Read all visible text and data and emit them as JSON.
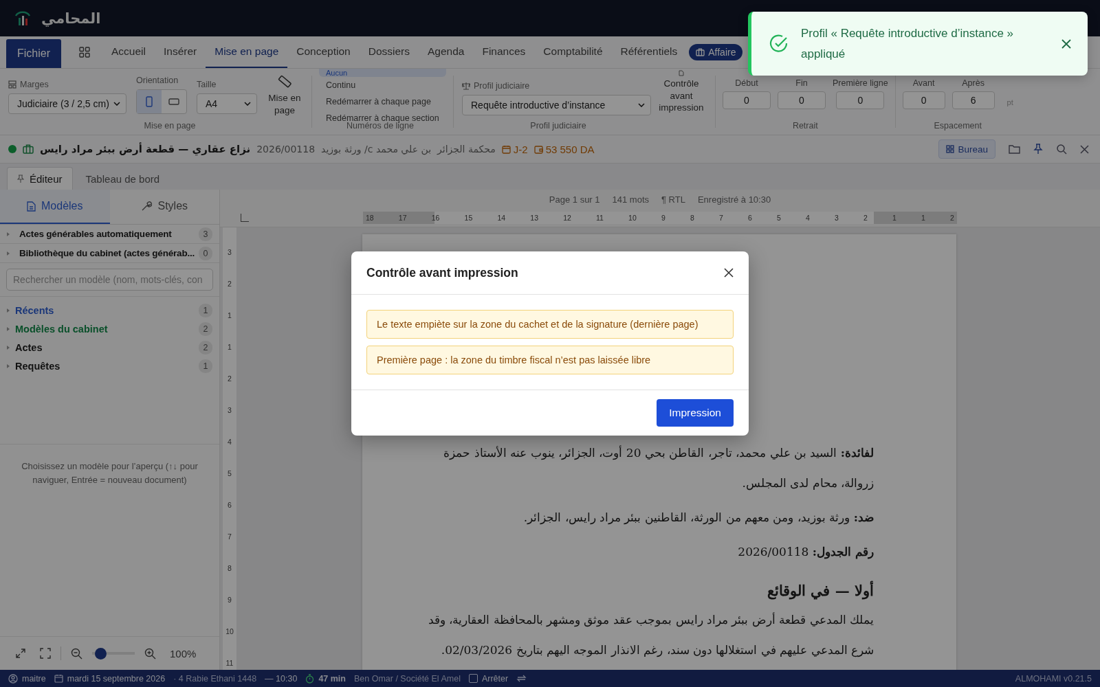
{
  "app": {
    "logo_text": "المحامي"
  },
  "menu": {
    "file_button": "Fichier",
    "tabs": [
      {
        "label": "Accueil",
        "selected": false
      },
      {
        "label": "Insérer",
        "selected": false
      },
      {
        "label": "Mise en page",
        "selected": true
      },
      {
        "label": "Conception",
        "selected": false
      },
      {
        "label": "Dossiers",
        "selected": false
      },
      {
        "label": "Agenda",
        "selected": false
      },
      {
        "label": "Finances",
        "selected": false
      },
      {
        "label": "Comptabilité",
        "selected": false
      },
      {
        "label": "Référentiels",
        "selected": false
      }
    ],
    "affaire_button": "Affaire"
  },
  "ribbon": {
    "margins": {
      "label": "Marges",
      "value": "Judiciaire (3 / 2,5 cm)"
    },
    "orientation": {
      "label": "Orientation",
      "options": [
        {
          "kind": "portrait",
          "selected": true
        },
        {
          "kind": "landscape",
          "selected": false
        }
      ]
    },
    "size": {
      "label": "Taille",
      "value": "A4"
    },
    "page_group_label": "Mise en page",
    "layout_button": "Mise en page",
    "line_numbers": {
      "options": [
        {
          "label": "Aucun",
          "selected": true
        },
        {
          "label": "Continu",
          "selected": false
        },
        {
          "label": "Redémarrer à chaque page",
          "selected": false
        },
        {
          "label": "Redémarrer à chaque section",
          "selected": false
        }
      ],
      "group_label": "Numéros de ligne"
    },
    "profile": {
      "label": "Profil judiciaire",
      "value": "Requête introductive d’instance",
      "group_label": "Profil judiciaire"
    },
    "print_check_button": "Contrôle avant impression",
    "indent": {
      "fields": [
        {
          "label": "Début",
          "value": "0"
        },
        {
          "label": "Fin",
          "value": "0"
        },
        {
          "label": "Première ligne",
          "value": "0"
        }
      ],
      "group_label": "Retrait"
    },
    "spacing": {
      "fields": [
        {
          "label": "Avant",
          "value": "0"
        },
        {
          "label": "Après",
          "value": "6"
        }
      ],
      "unit": "pt",
      "group_label": "Espacement"
    }
  },
  "case_bar": {
    "title": "نزاع عقاري — قطعة أرض ببئر مراد رايس",
    "number": "2026/00118",
    "parties": "بن علي محمد c/ ورثة بوزيد",
    "court": "محكمة الجزائر",
    "deadline": "J-2",
    "amount": "53 550 DA",
    "bureau_button": "Bureau"
  },
  "editor_tabs": [
    {
      "label": "Éditeur",
      "selected": true
    },
    {
      "label": "Tableau de bord",
      "selected": false
    }
  ],
  "sidebar": {
    "tabs": [
      {
        "label": "Modèles",
        "selected": true
      },
      {
        "label": "Styles",
        "selected": false
      }
    ],
    "sections": [
      {
        "label": "Actes générables automatiquement",
        "count": "3",
        "expanded": false
      },
      {
        "label": "Bibliothèque du cabinet (actes générab...",
        "count": "0",
        "expanded": false
      }
    ],
    "search": {
      "placeholder": "Rechercher un modèle (nom, mots-clés, con"
    },
    "categories": [
      {
        "label": "Récents",
        "count": "1",
        "kind": "recent",
        "expanded": false
      },
      {
        "label": "Modèles du cabinet",
        "count": "2",
        "kind": "firm",
        "expanded": false
      },
      {
        "label": "Actes",
        "count": "2",
        "kind": "folder",
        "expanded": false
      },
      {
        "label": "Requêtes",
        "count": "1",
        "kind": "folder",
        "expanded": false
      }
    ],
    "hint": "Choisissez un modèle pour l’aperçu (↑↓ pour naviguer, Entrée = nouveau document)",
    "zoom": {
      "level": 0.08,
      "reading": "100%"
    }
  },
  "document": {
    "status": [
      "Page 1 sur 1",
      "141 mots",
      "¶ RTL",
      "Enregistré à 10:30"
    ],
    "ruler": [
      "18",
      "17",
      "16",
      "15",
      "14",
      "13",
      "12",
      "11",
      "10",
      "9",
      "8",
      "7",
      "6",
      "5",
      "4",
      "3",
      "2",
      "1",
      "1",
      "2"
    ],
    "vertical_ruler": [
      "3",
      "2",
      "1",
      "1",
      "2",
      "3",
      "4",
      "5",
      "6",
      "7",
      "8",
      "9",
      "10",
      "11"
    ],
    "paragraphs": [
      {
        "kind": "text",
        "text": "**لفائدة:** السيد بن علي محمد، تاجر، القاطن بحي 20 أوت، الجزائر، ينوب عنه الأستاذ حمزة زروالة، محام لدى المجلس."
      },
      {
        "kind": "text",
        "text": "**ضد:** ورثة بوزيد، ومن معهم من الورثة، القاطنين ببئر مراد رايس، الجزائر."
      },
      {
        "kind": "text",
        "text": "**رقم الجدول:** 2026/00118"
      },
      {
        "kind": "heading",
        "text": "أولا — في الوقائع"
      },
      {
        "kind": "text",
        "text": "يملك المدعي قطعة أرض ببئر مراد رايس بموجب عقد موثق ومشهر بالمحافظة العقارية، وقد شرع المدعي عليهم في استغلالها دون سند، رغم الانذار الموجه اليهم بتاريخ 02/03/2026."
      }
    ]
  },
  "status_bar": {
    "user": "maitre",
    "date": "mardi 15 septembre 2026",
    "hijri": "· 4 Rabie Ethani 1448",
    "time": "— 10:30",
    "timer": "47 min",
    "client": "Ben Omar / Société El Amel",
    "stop": {
      "label": "Arrêter",
      "checked": false
    },
    "version": "ALMOHAMI v0.21.5"
  },
  "modal": {
    "title": "Contrôle avant impression",
    "warnings": [
      "Le texte empiète sur la zone du cachet et de la signature (dernière page)",
      "Première page : la zone du timbre fiscal n’est pas laissée libre"
    ],
    "button": "Impression"
  },
  "toast": {
    "text": "Profil « Requête introductive d’instance » appliqué"
  }
}
